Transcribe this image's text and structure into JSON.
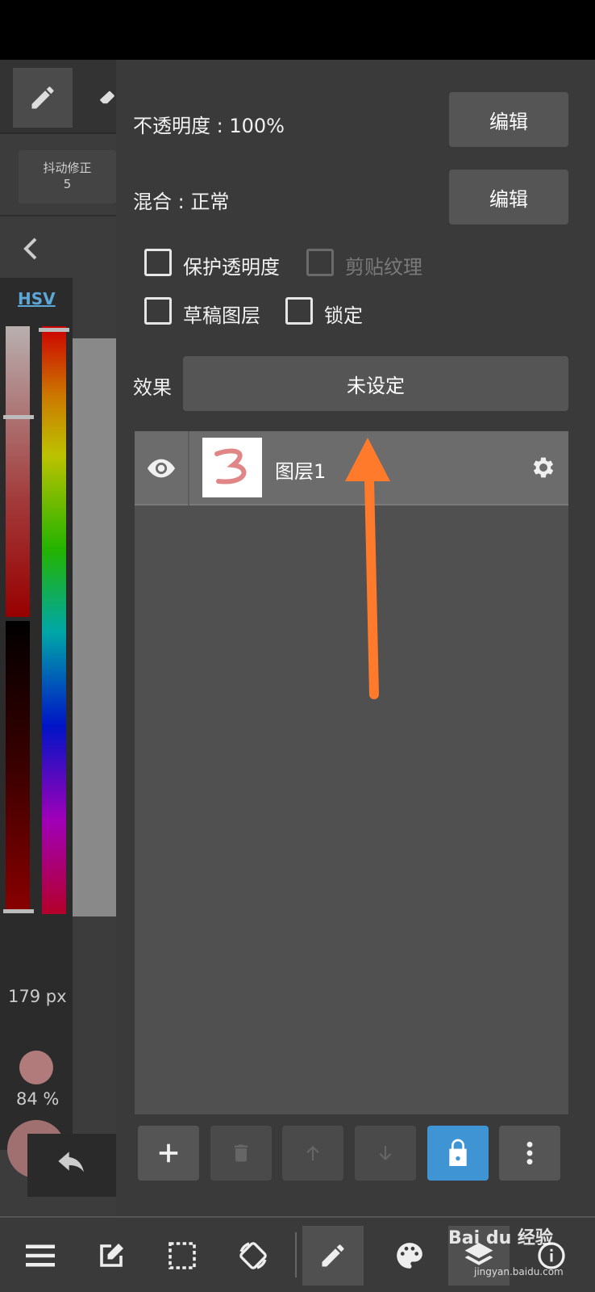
{
  "left_panel": {
    "stabilizer_label": "抖动修正",
    "stabilizer_value": "5",
    "color_mode": "HSV",
    "brush_size": "179 px",
    "brush_opacity": "84 %"
  },
  "layer_panel": {
    "opacity_label": "不透明度 : 100%",
    "opacity_edit": "编辑",
    "blend_label": "混合 : 正常",
    "blend_edit": "编辑",
    "checkboxes": {
      "protect_alpha": "保护透明度",
      "clipping": "剪贴纹理",
      "draft_layer": "草稿图层",
      "lock": "锁定"
    },
    "effect_label": "效果",
    "effect_value": "未设定",
    "layers": [
      {
        "name": "图层1",
        "thumb_text": "3",
        "visible": true
      }
    ]
  },
  "watermark": {
    "brand": "Bai du 经验",
    "url": "jingyan.baidu.com"
  },
  "colors": {
    "accent_lock": "#3f94d4",
    "annotation_arrow": "#ff7a2a",
    "hsv_label": "#5aa7d8"
  }
}
